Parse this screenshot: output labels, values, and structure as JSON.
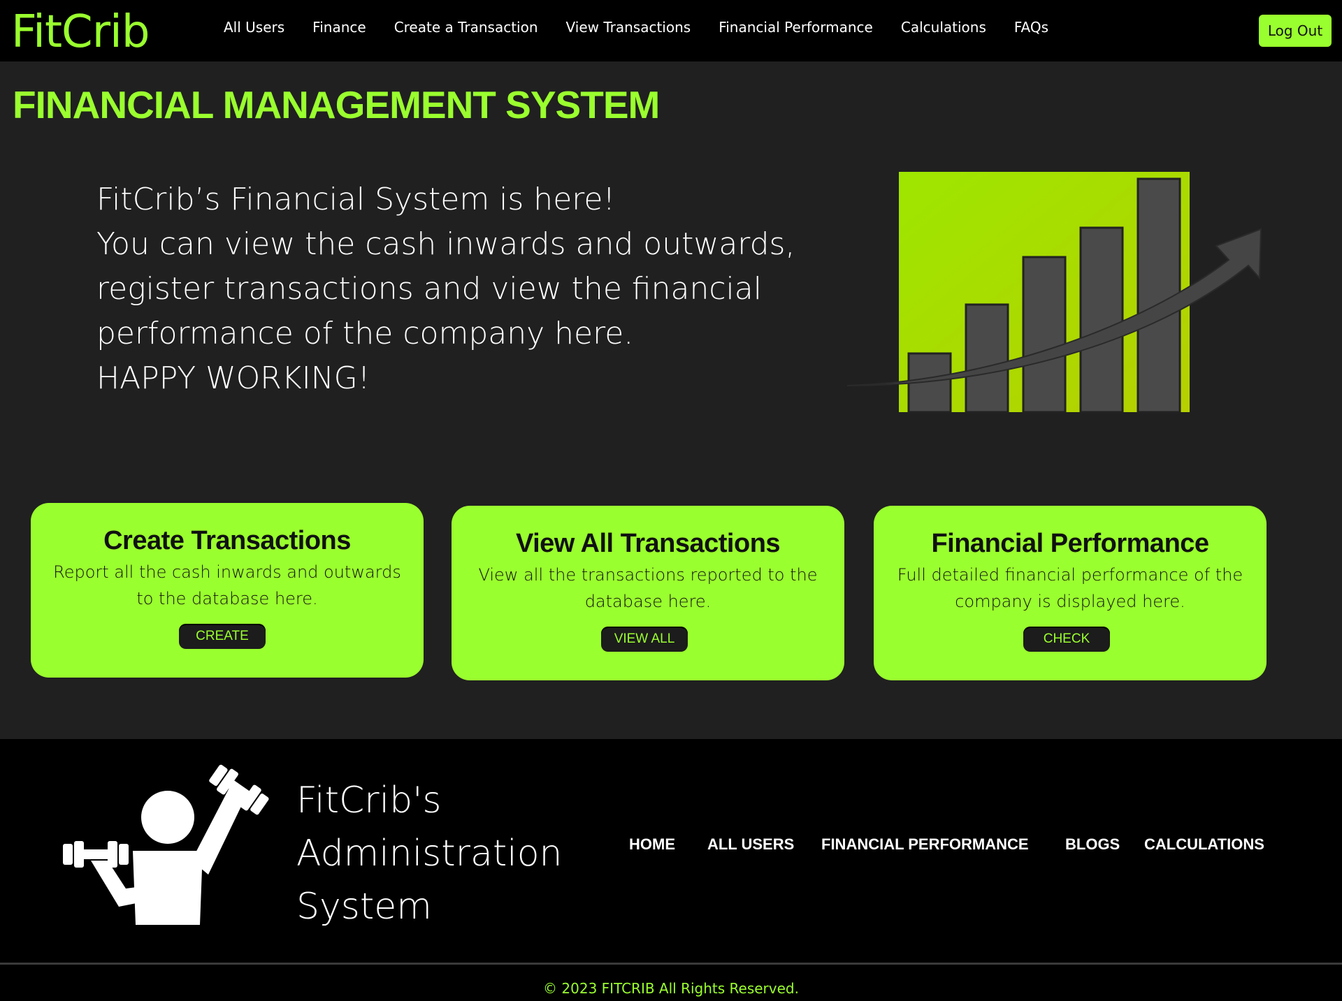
{
  "navbar": {
    "brand": "FitCrib",
    "links": [
      "All Users",
      "Finance",
      "Create a Transaction",
      "View Transactions",
      "Financial Performance",
      "Calculations",
      "FAQs"
    ],
    "logout_label": "Log Out"
  },
  "hero": {
    "title": "FINANCIAL MANAGEMENT SYSTEM",
    "lines": [
      "FitCrib’s Financial System is here!",
      "You can view the cash inwards and outwards,",
      "register transactions and view the financial",
      "performance of the company here.",
      "HAPPY WORKING!"
    ],
    "illustration": "bar-growth-chart-icon"
  },
  "cards": [
    {
      "title": "Create Transactions",
      "description": "Report all the cash inwards and outwards to the database here.",
      "button": "CREATE"
    },
    {
      "title": "View All Transactions",
      "description": "View all the transactions reported to the database here.",
      "button": "VIEW ALL"
    },
    {
      "title": "Financial Performance",
      "description": "Full detailed financial performance of the company is displayed here.",
      "button": "CHECK"
    }
  ],
  "footer": {
    "brand_lines": [
      "FitCrib's",
      "Administration",
      "System"
    ],
    "logo": "person-lifting-dumbbells-icon",
    "links": [
      "HOME",
      "ALL USERS",
      "FINANCIAL PERFORMANCE",
      "BLOGS",
      "CALCULATIONS"
    ],
    "copyright": "© 2023 FITCRIB All Rights Reserved."
  },
  "colors": {
    "accent": "#9aff2e",
    "background": "#202020",
    "navbar": "#000000",
    "chart_bar": "#4a4a4a",
    "chart_square": "#a8d400"
  }
}
